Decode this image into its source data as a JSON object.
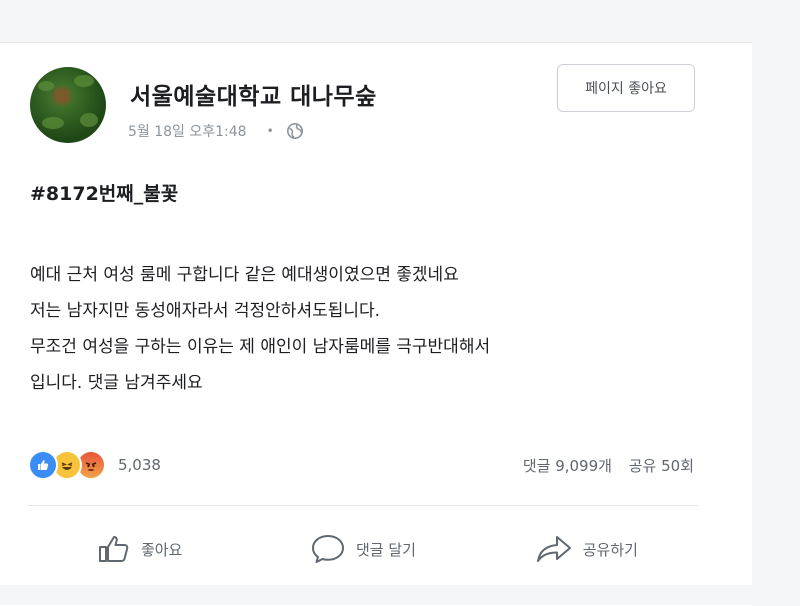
{
  "page": {
    "name": "서울예술대학교 대나무숲",
    "timestamp": "5월 18일 오후1:48",
    "separator": "•",
    "privacy_icon": "globe-icon",
    "like_page_label": "페이지 좋아요"
  },
  "post": {
    "hashtag": "#8172번째_불꽃",
    "lines": [
      "예대 근처 여성 룸메 구합니다  같은 예대생이였으면 좋겠네요",
      "저는 남자지만 동성애자라서 걱정안하셔도됩니다.",
      "무조건 여성을 구하는 이유는 제 애인이 남자룸메를 극구반대해서",
      "입니다.  댓글 남겨주세요"
    ]
  },
  "engagement": {
    "reaction_icons": [
      "like-reaction-icon",
      "haha-reaction-icon",
      "angry-reaction-icon"
    ],
    "reaction_count": "5,038",
    "comments": "댓글 9,099개",
    "shares": "공유 50회"
  },
  "actions": {
    "like": "좋아요",
    "comment": "댓글 달기",
    "share": "공유하기"
  },
  "colors": {
    "like_blue": "#3b8df5",
    "haha_yellow": "#f7c33b",
    "angry_red": "#e8553a",
    "muted_text": "#606770"
  }
}
